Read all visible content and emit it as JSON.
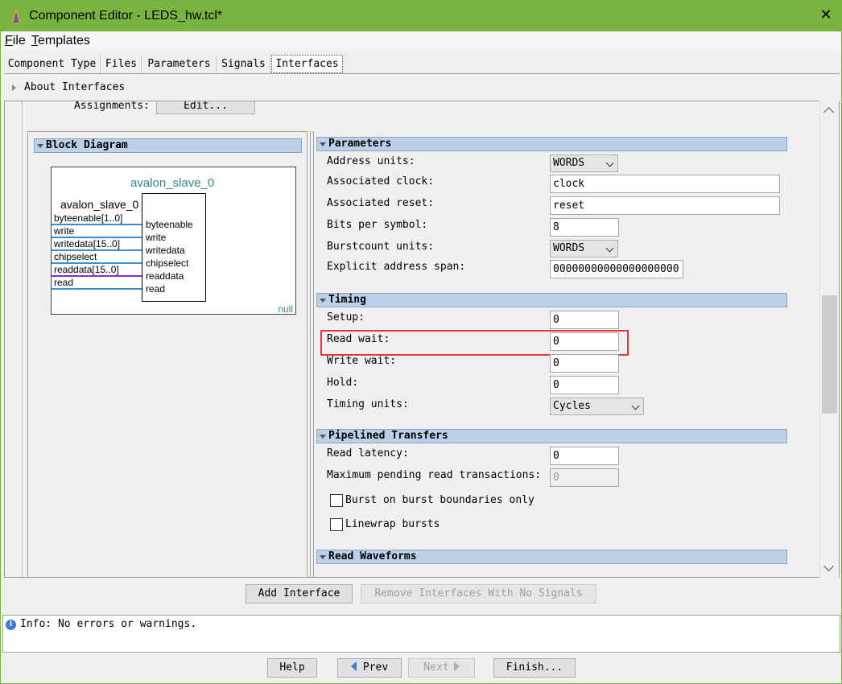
{
  "window": {
    "title": "Component Editor - LEDS_hw.tcl*",
    "close_glyph": "✕"
  },
  "menu": {
    "file_u": "F",
    "file_rest": "ile",
    "templates_u": "T",
    "templates_rest": "emplates"
  },
  "tabs": [
    {
      "label": "Component Type"
    },
    {
      "label": "Files"
    },
    {
      "label": "Parameters"
    },
    {
      "label": "Signals"
    },
    {
      "label": "Interfaces"
    }
  ],
  "about": "About Interfaces",
  "assignments": {
    "label": "Assignments:",
    "edit": "Edit..."
  },
  "block_diagram": {
    "header": "Block Diagram",
    "interface_title": "avalon_slave_0",
    "box_name": "avalon_slave_0",
    "signals": [
      "byteenable[1..0]",
      "write",
      "writedata[15..0]",
      "chipselect",
      "readdata[15..0]",
      "read"
    ],
    "ports": [
      "byteenable",
      "write",
      "writedata",
      "chipselect",
      "readdata",
      "read"
    ],
    "footer": "null"
  },
  "parameters": {
    "header": "Parameters",
    "address_units": {
      "label": "Address units:",
      "value": "WORDS"
    },
    "associated_clock": {
      "label": "Associated clock:",
      "value": "clock"
    },
    "associated_reset": {
      "label": "Associated reset:",
      "value": "reset"
    },
    "bits_per_symbol": {
      "label": "Bits per symbol:",
      "value": "8"
    },
    "burstcount_units": {
      "label": "Burstcount units:",
      "value": "WORDS"
    },
    "explicit_span": {
      "label": "Explicit address span:",
      "value": "00000000000000000000"
    }
  },
  "timing": {
    "header": "Timing",
    "setup": {
      "label": "Setup:",
      "value": "0"
    },
    "read_wait": {
      "label": "Read wait:",
      "value": "0"
    },
    "write_wait": {
      "label": "Write wait:",
      "value": "0"
    },
    "hold": {
      "label": "Hold:",
      "value": "0"
    },
    "timing_units": {
      "label": "Timing units:",
      "value": "Cycles"
    }
  },
  "pipelined": {
    "header": "Pipelined Transfers",
    "read_latency": {
      "label": "Read latency:",
      "value": "0"
    },
    "max_pending": {
      "label": "Maximum pending read transactions:",
      "value": "0"
    },
    "burst_boundaries": {
      "label": "Burst on burst boundaries only",
      "checked": false
    },
    "linewrap": {
      "label": "Linewrap bursts",
      "checked": false
    }
  },
  "read_waveforms": {
    "header": "Read Waveforms"
  },
  "buttons": {
    "add_interface": "Add Interface",
    "remove_no_signals": "Remove Interfaces With No Signals"
  },
  "message": "Info: No errors or warnings.",
  "nav": {
    "help": "Help",
    "prev": "Prev",
    "next": "Next",
    "finish": "Finish..."
  }
}
